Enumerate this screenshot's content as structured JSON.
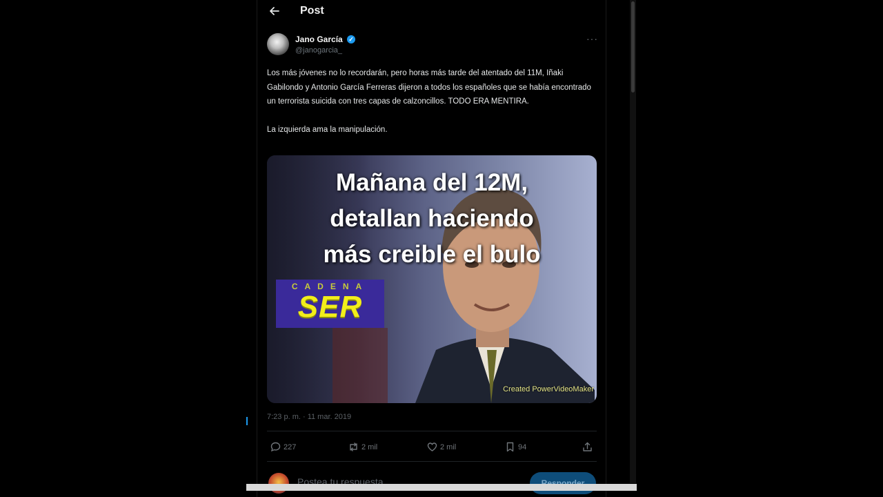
{
  "topbar": {
    "title": "Post"
  },
  "author": {
    "name": "Jano García",
    "handle": "@janogarcia_"
  },
  "tweet": {
    "paragraphs": [
      "Los más jóvenes no lo recordarán, pero horas más tarde del atentado del 11M, Iñaki Gabilondo y Antonio García Ferreras dijeron a todos los españoles que se había encontrado un terrorista suicida con tres capas de calzoncillos. TODO ERA MENTIRA.",
      "La izquierda ama la manipulación."
    ]
  },
  "media": {
    "headline_lines": [
      "Mañana del 12M,",
      "detallan haciendo",
      "más creible el bulo"
    ],
    "logo_top": "CADENA",
    "logo_main": "SER",
    "watermark": "Created PowerVideoMaker"
  },
  "timestamp": "7:23 p. m. · 11 mar. 2019",
  "actions": {
    "replies": "227",
    "reposts": "2 mil",
    "likes": "2 mil",
    "bookmarks": "94"
  },
  "reply_bar": {
    "placeholder": "Postea tu respuesta",
    "button_label": "Responder"
  },
  "colors": {
    "background": "#000000",
    "accent": "#1d9bf0",
    "text": "#e7e9ea",
    "muted": "#71767b"
  },
  "icons": [
    "back-arrow-icon",
    "verified-badge-icon",
    "more-icon",
    "reply-icon",
    "repost-icon",
    "like-icon",
    "bookmark-icon",
    "share-icon"
  ]
}
